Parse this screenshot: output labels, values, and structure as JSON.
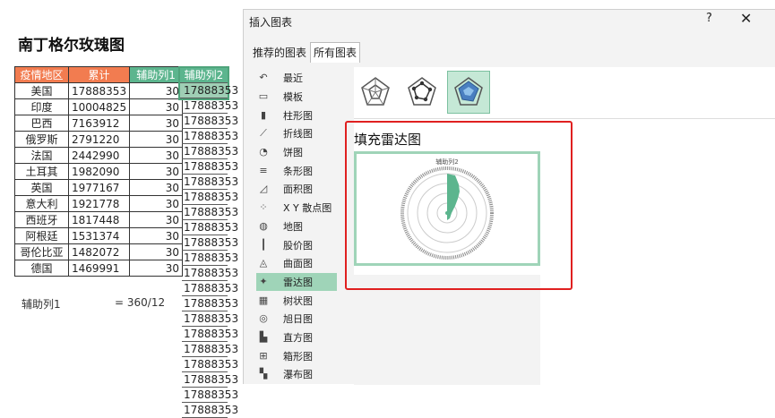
{
  "sheet": {
    "title": "南丁格尔玫瑰图",
    "headers": [
      "疫情地区",
      "累计",
      "辅助列1",
      "辅助列2"
    ],
    "rows": [
      {
        "region": "美国",
        "total": "17888353",
        "aux1": "30"
      },
      {
        "region": "印度",
        "total": "10004825",
        "aux1": "30"
      },
      {
        "region": "巴西",
        "total": "7163912",
        "aux1": "30"
      },
      {
        "region": "俄罗斯",
        "total": "2791220",
        "aux1": "30"
      },
      {
        "region": "法国",
        "total": "2442990",
        "aux1": "30"
      },
      {
        "region": "土耳其",
        "total": "1982090",
        "aux1": "30"
      },
      {
        "region": "英国",
        "total": "1977167",
        "aux1": "30"
      },
      {
        "region": "意大利",
        "total": "1921778",
        "aux1": "30"
      },
      {
        "region": "西班牙",
        "total": "1817448",
        "aux1": "30"
      },
      {
        "region": "阿根廷",
        "total": "1531374",
        "aux1": "30"
      },
      {
        "region": "哥伦比亚",
        "total": "1482072",
        "aux1": "30"
      },
      {
        "region": "德国",
        "total": "1469991",
        "aux1": "30"
      }
    ],
    "aux2_values": [
      "17888353",
      "17888353",
      "17888353",
      "17888353",
      "17888353",
      "17888353",
      "17888353",
      "17888353",
      "17888353",
      "17888353",
      "17888353",
      "17888353",
      "17888353",
      "17888353",
      "17888353",
      "17888353",
      "17888353",
      "17888353",
      "17888353",
      "17888353",
      "17888353",
      "17888353"
    ],
    "note_label": "辅助列1",
    "note_formula": "= 360/12"
  },
  "dialog": {
    "title": "插入图表",
    "help": "?",
    "close": "✕",
    "tabs": [
      "推荐的图表",
      "所有图表"
    ],
    "chart_types": [
      {
        "label": "最近",
        "icon": "recent-icon",
        "glyph": "↶"
      },
      {
        "label": "模板",
        "icon": "template-icon",
        "glyph": "▭"
      },
      {
        "label": "柱形图",
        "icon": "column-chart-icon",
        "glyph": "▮"
      },
      {
        "label": "折线图",
        "icon": "line-chart-icon",
        "glyph": "⟋"
      },
      {
        "label": "饼图",
        "icon": "pie-chart-icon",
        "glyph": "◔"
      },
      {
        "label": "条形图",
        "icon": "bar-chart-icon",
        "glyph": "≡"
      },
      {
        "label": "面积图",
        "icon": "area-chart-icon",
        "glyph": "◿"
      },
      {
        "label": "X Y 散点图",
        "icon": "scatter-chart-icon",
        "glyph": "⁘"
      },
      {
        "label": "地图",
        "icon": "map-chart-icon",
        "glyph": "◍"
      },
      {
        "label": "股价图",
        "icon": "stock-chart-icon",
        "glyph": "┃"
      },
      {
        "label": "曲面图",
        "icon": "surface-chart-icon",
        "glyph": "◬"
      },
      {
        "label": "雷达图",
        "icon": "radar-chart-icon",
        "glyph": "✦"
      },
      {
        "label": "树状图",
        "icon": "treemap-chart-icon",
        "glyph": "▦"
      },
      {
        "label": "旭日图",
        "icon": "sunburst-chart-icon",
        "glyph": "◎"
      },
      {
        "label": "直方图",
        "icon": "histogram-chart-icon",
        "glyph": "▙"
      },
      {
        "label": "箱形图",
        "icon": "box-chart-icon",
        "glyph": "⊞"
      },
      {
        "label": "瀑布图",
        "icon": "waterfall-chart-icon",
        "glyph": "▚"
      }
    ],
    "selected_type": "雷达图",
    "subtype_icons": [
      "radar-basic-icon",
      "radar-markers-icon",
      "radar-filled-icon"
    ],
    "preview_title": "填充雷达图",
    "preview_chart_title": "辅助列2",
    "accent_color": "#5cb58e",
    "highlight_color": "#e02020"
  }
}
